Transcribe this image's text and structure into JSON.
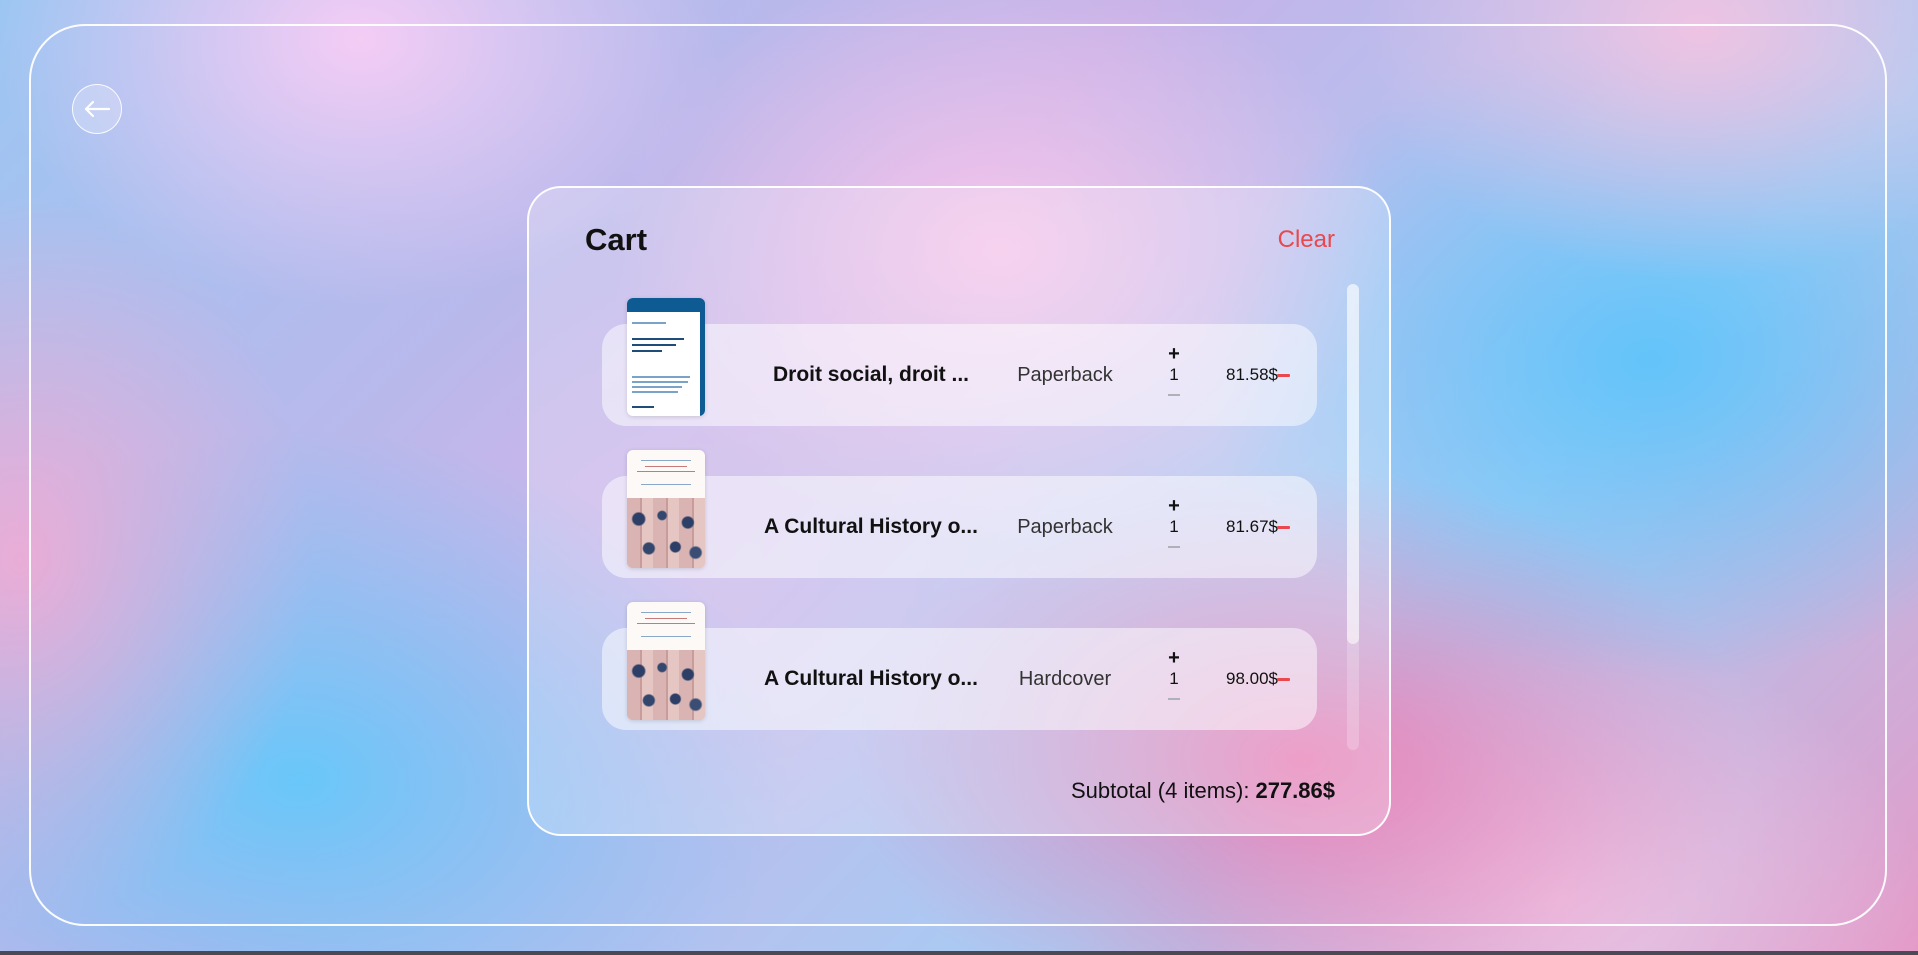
{
  "navigation": {
    "back_icon": "arrow-left-icon"
  },
  "cart": {
    "title": "Cart",
    "clear_label": "Clear",
    "items": [
      {
        "title": "Droit social, droit ...",
        "format": "Paperback",
        "quantity": "1",
        "price": "81.58$",
        "increment_icon": "plus-icon",
        "remove_icon": "minus-icon"
      },
      {
        "title": "A Cultural History o...",
        "format": "Paperback",
        "quantity": "1",
        "price": "81.67$",
        "increment_icon": "plus-icon",
        "remove_icon": "minus-icon"
      },
      {
        "title": "A Cultural History o...",
        "format": "Hardcover",
        "quantity": "1",
        "price": "98.00$",
        "increment_icon": "plus-icon",
        "remove_icon": "minus-icon"
      }
    ],
    "subtotal_label": "Subtotal (4 items):",
    "subtotal_value": "277.86$",
    "plus_symbol": "+"
  },
  "colors": {
    "accent_red": "#e8484e",
    "book_blue": "#0e5a93",
    "frame_white": "#ffffff"
  }
}
